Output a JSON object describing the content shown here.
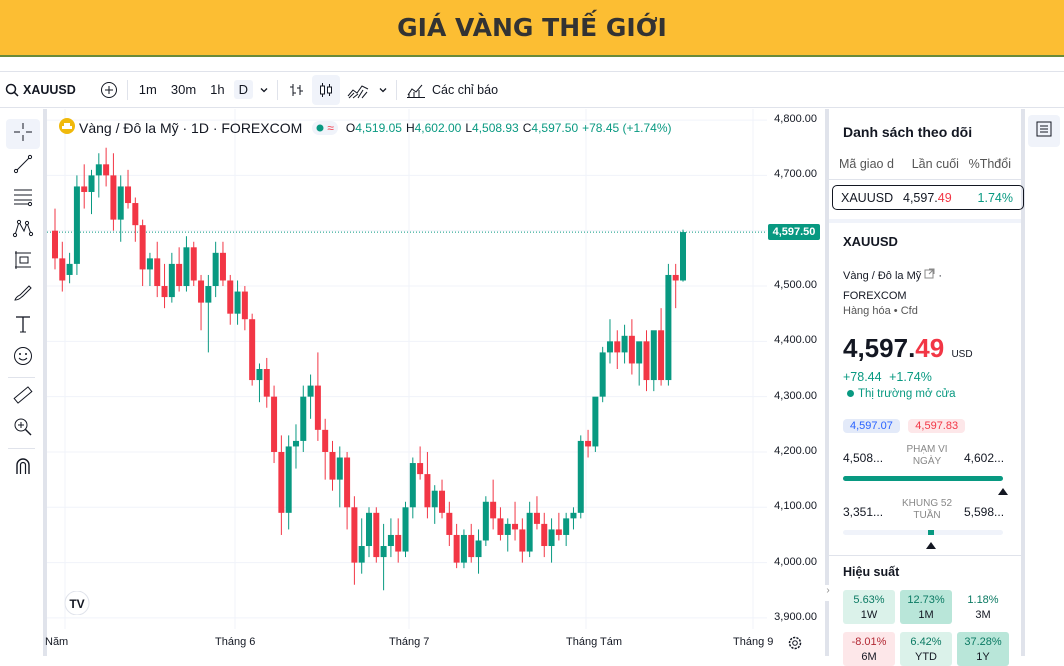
{
  "banner": {
    "title": "GIÁ VÀNG THẾ GIỚI"
  },
  "toolbar": {
    "symbol": "XAUUSD",
    "timeframes": [
      "1m",
      "30m",
      "1h",
      "D"
    ],
    "indicators_label": "Các chỉ báo"
  },
  "legend": {
    "instrument": "Vàng / Đô la Mỹ · 1D · FOREXCOM",
    "open_label": "O",
    "open": "4,519.05",
    "high_label": "H",
    "high": "4,602.00",
    "low_label": "L",
    "low": "4,508.93",
    "close_label": "C",
    "close": "4,597.50",
    "change": "+78.45 (+1.74%)"
  },
  "price_tag": "4,597.50",
  "chart_data": {
    "type": "candlestick",
    "y_ticks": [
      "4,800.00",
      "4,700.00",
      "4,600.00",
      "4,500.00",
      "4,400.00",
      "4,300.00",
      "4,200.00",
      "4,100.00",
      "4,000.00",
      "3,900.00"
    ],
    "ylim": [
      3880,
      4820
    ],
    "x_ticks": [
      "Năm",
      "Tháng 6",
      "Tháng 7",
      "Tháng Tám",
      "Tháng 9"
    ],
    "last_price": 4597.5,
    "candles": [
      [
        4600,
        4640,
        4530,
        4550
      ],
      [
        4550,
        4580,
        4490,
        4510
      ],
      [
        4520,
        4560,
        4505,
        4540
      ],
      [
        4540,
        4700,
        4520,
        4680
      ],
      [
        4680,
        4720,
        4640,
        4670
      ],
      [
        4670,
        4710,
        4630,
        4700
      ],
      [
        4700,
        4740,
        4660,
        4720
      ],
      [
        4720,
        4750,
        4680,
        4700
      ],
      [
        4700,
        4740,
        4600,
        4620
      ],
      [
        4620,
        4700,
        4580,
        4680
      ],
      [
        4680,
        4710,
        4640,
        4650
      ],
      [
        4650,
        4660,
        4580,
        4610
      ],
      [
        4610,
        4620,
        4500,
        4530
      ],
      [
        4530,
        4560,
        4500,
        4550
      ],
      [
        4550,
        4580,
        4480,
        4500
      ],
      [
        4500,
        4540,
        4460,
        4480
      ],
      [
        4480,
        4560,
        4470,
        4540
      ],
      [
        4540,
        4570,
        4490,
        4500
      ],
      [
        4500,
        4590,
        4490,
        4570
      ],
      [
        4570,
        4580,
        4500,
        4510
      ],
      [
        4510,
        4520,
        4420,
        4470
      ],
      [
        4470,
        4520,
        4380,
        4500
      ],
      [
        4500,
        4580,
        4480,
        4560
      ],
      [
        4560,
        4580,
        4500,
        4510
      ],
      [
        4510,
        4520,
        4430,
        4450
      ],
      [
        4450,
        4510,
        4430,
        4490
      ],
      [
        4490,
        4500,
        4420,
        4440
      ],
      [
        4440,
        4450,
        4320,
        4330
      ],
      [
        4330,
        4360,
        4290,
        4350
      ],
      [
        4350,
        4370,
        4280,
        4300
      ],
      [
        4300,
        4320,
        4180,
        4200
      ],
      [
        4200,
        4230,
        4050,
        4090
      ],
      [
        4090,
        4230,
        4060,
        4210
      ],
      [
        4210,
        4250,
        4170,
        4220
      ],
      [
        4220,
        4320,
        4200,
        4300
      ],
      [
        4300,
        4340,
        4260,
        4320
      ],
      [
        4320,
        4380,
        4220,
        4240
      ],
      [
        4240,
        4260,
        4150,
        4200
      ],
      [
        4200,
        4220,
        4130,
        4150
      ],
      [
        4150,
        4210,
        4100,
        4190
      ],
      [
        4190,
        4200,
        4060,
        4100
      ],
      [
        4100,
        4120,
        3960,
        4000
      ],
      [
        4000,
        4080,
        3980,
        4030
      ],
      [
        4030,
        4100,
        4010,
        4090
      ],
      [
        4090,
        4100,
        4000,
        4010
      ],
      [
        4010,
        4070,
        3950,
        4030
      ],
      [
        4030,
        4080,
        4010,
        4050
      ],
      [
        4050,
        4080,
        4000,
        4020
      ],
      [
        4020,
        4110,
        4010,
        4100
      ],
      [
        4100,
        4190,
        4080,
        4180
      ],
      [
        4180,
        4210,
        4150,
        4160
      ],
      [
        4160,
        4200,
        4080,
        4100
      ],
      [
        4100,
        4140,
        4070,
        4130
      ],
      [
        4130,
        4150,
        4080,
        4090
      ],
      [
        4090,
        4110,
        4030,
        4050
      ],
      [
        4050,
        4070,
        3990,
        4000
      ],
      [
        4000,
        4060,
        3990,
        4050
      ],
      [
        4050,
        4070,
        4000,
        4010
      ],
      [
        4010,
        4060,
        3980,
        4040
      ],
      [
        4040,
        4120,
        4030,
        4110
      ],
      [
        4110,
        4150,
        4060,
        4080
      ],
      [
        4080,
        4100,
        4040,
        4050
      ],
      [
        4050,
        4080,
        4020,
        4070
      ],
      [
        4070,
        4110,
        4040,
        4060
      ],
      [
        4060,
        4080,
        4000,
        4020
      ],
      [
        4020,
        4110,
        4010,
        4090
      ],
      [
        4090,
        4120,
        4060,
        4070
      ],
      [
        4070,
        4090,
        4010,
        4030
      ],
      [
        4030,
        4080,
        4000,
        4060
      ],
      [
        4060,
        4090,
        4040,
        4050
      ],
      [
        4050,
        4090,
        4030,
        4080
      ],
      [
        4080,
        4100,
        4060,
        4090
      ],
      [
        4090,
        4230,
        4080,
        4220
      ],
      [
        4220,
        4240,
        4190,
        4210
      ],
      [
        4210,
        4260,
        4200,
        4300
      ],
      [
        4300,
        4390,
        4290,
        4380
      ],
      [
        4380,
        4440,
        4360,
        4400
      ],
      [
        4400,
        4420,
        4350,
        4380
      ],
      [
        4380,
        4430,
        4360,
        4410
      ],
      [
        4410,
        4440,
        4340,
        4360
      ],
      [
        4360,
        4380,
        4320,
        4400
      ],
      [
        4400,
        4420,
        4310,
        4330
      ],
      [
        4330,
        4360,
        4310,
        4420
      ],
      [
        4420,
        4460,
        4320,
        4330
      ],
      [
        4330,
        4540,
        4320,
        4520
      ],
      [
        4520,
        4540,
        4460,
        4510
      ],
      [
        4510,
        4602,
        4508,
        4597.5
      ]
    ]
  },
  "watchlist": {
    "title": "Danh sách theo dõi",
    "headers": [
      "Mã giao d",
      "Lần cuối",
      "%Thđổi"
    ],
    "row": {
      "symbol": "XAUUSD",
      "last_main": "4,597.",
      "last_tail": "49",
      "change": "1.74%"
    }
  },
  "details": {
    "symbol": "XAUUSD",
    "name": "Vàng / Đô la Mỹ",
    "exchange_sep": "·",
    "exchange": "FOREXCOM",
    "category": "Hàng hóa",
    "category_sep": "•",
    "type": "Cfd",
    "price_main": "4,597.",
    "price_tail": "49",
    "currency": "USD",
    "change_abs": "+78.44",
    "change_pct": "+1.74%",
    "market_status": "Thị trường mở cửa",
    "bid": "4,597.07",
    "ask": "4,597.83",
    "day_range_label": "PHẠM VI NGÀY",
    "day_low": "4,508...",
    "day_high": "4,602...",
    "day_range_fraction": 1.0,
    "w52_label": "KHUNG 52 TUẦN",
    "w52_low": "3,351...",
    "w52_high": "5,598...",
    "w52_fraction": 0.55,
    "perf_title": "Hiệu suất",
    "perf": [
      {
        "value": "5.63%",
        "label": "1W"
      },
      {
        "value": "12.73%",
        "label": "1M"
      },
      {
        "value": "1.18%",
        "label": "3M"
      },
      {
        "value": "-8.01%",
        "label": "6M"
      },
      {
        "value": "6.42%",
        "label": "YTD"
      },
      {
        "value": "37.28%",
        "label": "1Y"
      }
    ]
  },
  "colors": {
    "up": "#089981",
    "down": "#f23645",
    "banner": "#fcbe33"
  }
}
